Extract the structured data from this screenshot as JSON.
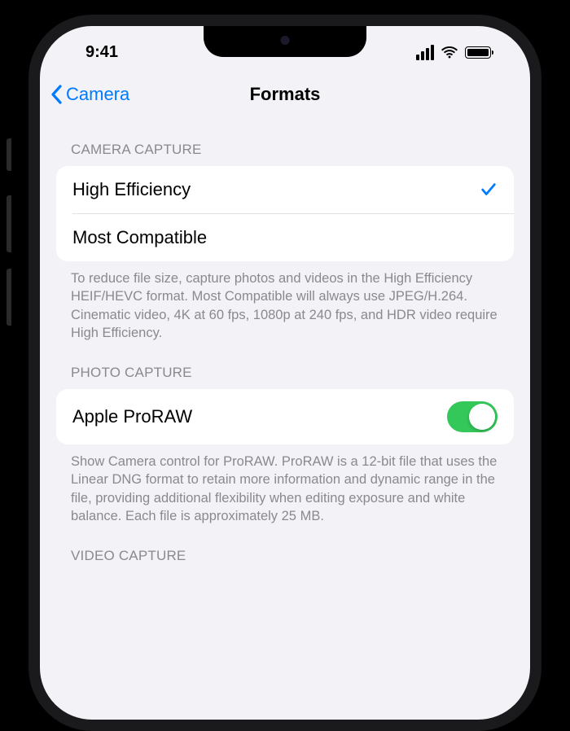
{
  "statusBar": {
    "time": "9:41"
  },
  "nav": {
    "backLabel": "Camera",
    "title": "Formats"
  },
  "sections": {
    "cameraCapture": {
      "header": "CAMERA CAPTURE",
      "options": [
        {
          "label": "High Efficiency",
          "selected": true
        },
        {
          "label": "Most Compatible",
          "selected": false
        }
      ],
      "footer": "To reduce file size, capture photos and videos in the High Efficiency HEIF/HEVC format. Most Compatible will always use JPEG/H.264. Cinematic video, 4K at 60 fps, 1080p at 240 fps, and HDR video require High Efficiency."
    },
    "photoCapture": {
      "header": "PHOTO CAPTURE",
      "row": {
        "label": "Apple ProRAW",
        "enabled": true
      },
      "footer": "Show Camera control for ProRAW. ProRAW is a 12-bit file that uses the Linear DNG format to retain more information and dynamic range in the file, providing additional flexibility when editing exposure and white balance. Each file is approximately 25 MB."
    },
    "videoCapture": {
      "header": "VIDEO CAPTURE"
    }
  }
}
